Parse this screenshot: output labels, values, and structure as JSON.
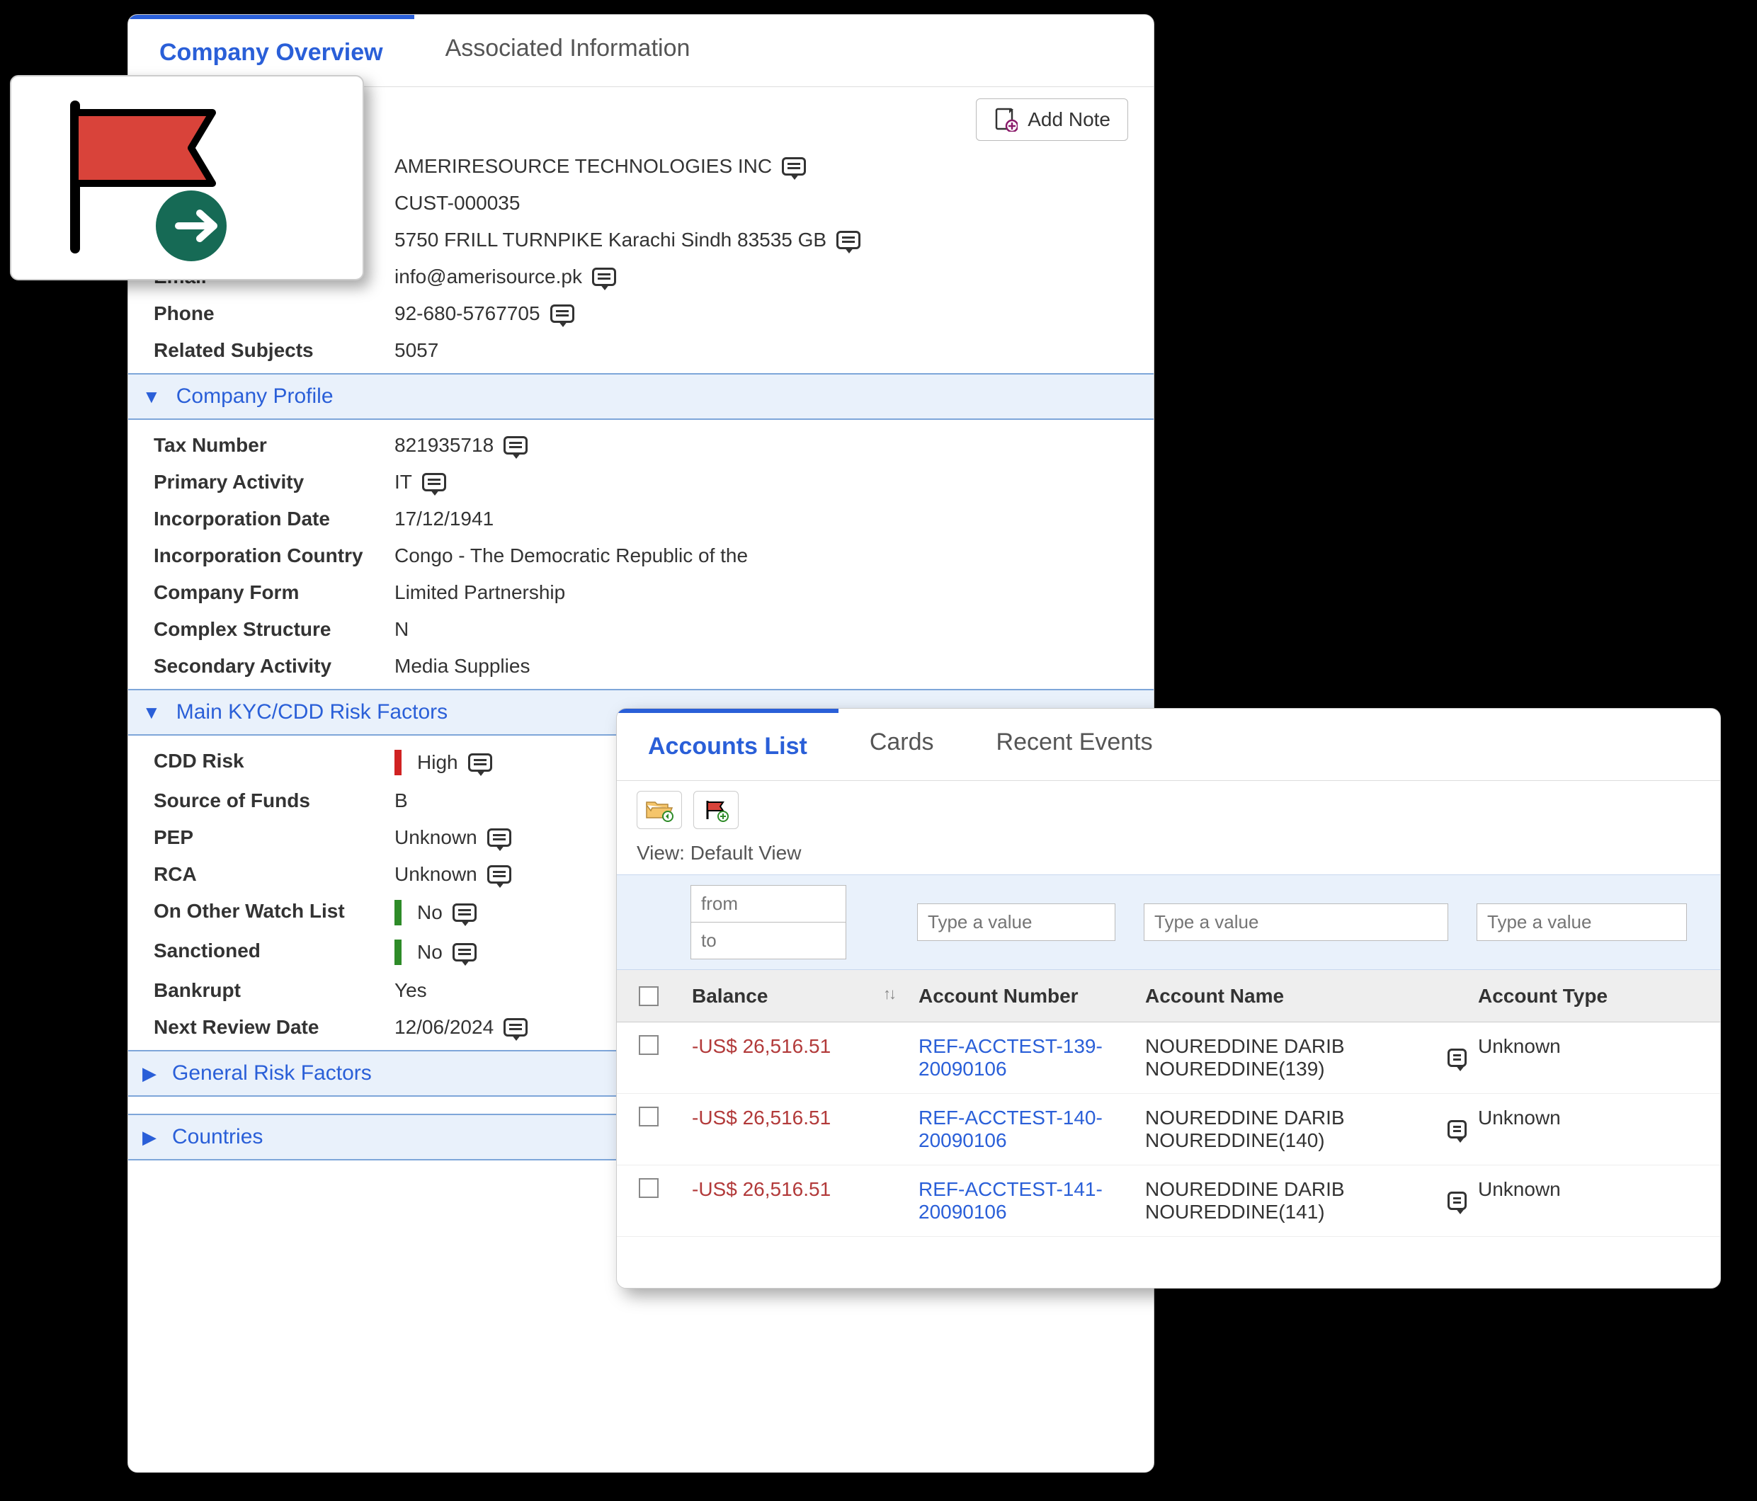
{
  "main": {
    "tabs": {
      "overview": "Company Overview",
      "associated": "Associated Information"
    },
    "add_note_label": "Add Note",
    "company_name": "AMERIRESOURCE TECHNOLOGIES INC",
    "customer_id": "CUST-000035",
    "address": "5750 FRILL TURNPIKE Karachi Sindh 83535 GB",
    "fields": {
      "email_label": "Email",
      "email": "info@amerisource.pk",
      "phone_label": "Phone",
      "phone": "92-680-5767705",
      "related_label": "Related Subjects",
      "related": "5057"
    },
    "sections": {
      "profile": "Company Profile",
      "kyc": "Main KYC/CDD Risk Factors",
      "general": "General Risk Factors",
      "countries": "Countries"
    },
    "profile": {
      "tax_label": "Tax Number",
      "tax": "821935718",
      "activity_label": "Primary Activity",
      "activity": "IT",
      "inc_date_label": "Incorporation Date",
      "inc_date": "17/12/1941",
      "inc_country_label": "Incorporation Country",
      "inc_country": "Congo - The Democratic Republic of the",
      "form_label": "Company Form",
      "form": "Limited Partnership",
      "complex_label": "Complex Structure",
      "complex": "N",
      "secondary_label": "Secondary Activity",
      "secondary": "Media Supplies"
    },
    "kyc": {
      "cdd_label": "CDD Risk",
      "cdd": "High",
      "sof_label": "Source of Funds",
      "sof": "B",
      "pep_label": "PEP",
      "pep": "Unknown",
      "rca_label": "RCA",
      "rca": "Unknown",
      "watch_label": "On Other Watch List",
      "watch": "No",
      "sanctioned_label": "Sanctioned",
      "sanctioned": "No",
      "bankrupt_label": "Bankrupt",
      "bankrupt": "Yes",
      "nextreview_label": "Next Review Date",
      "nextreview": "12/06/2024"
    }
  },
  "accounts": {
    "tabs": {
      "list": "Accounts List",
      "cards": "Cards",
      "events": "Recent Events"
    },
    "view_prefix": "View: ",
    "view_name": "Default View",
    "filters": {
      "balance_from": "from",
      "balance_to": "to",
      "generic": "Type a value"
    },
    "headers": {
      "balance": "Balance",
      "number": "Account Number",
      "name": "Account Name",
      "type": "Account Type"
    },
    "rows": [
      {
        "balance": "-US$ 26,516.51",
        "number": "REF-ACCTEST-139-20090106",
        "name": "NOUREDDINE  DARIB NOUREDDINE(139)",
        "type": "Unknown"
      },
      {
        "balance": "-US$ 26,516.51",
        "number": "REF-ACCTEST-140-20090106",
        "name": "NOUREDDINE  DARIB NOUREDDINE(140)",
        "type": "Unknown"
      },
      {
        "balance": "-US$ 26,516.51",
        "number": "REF-ACCTEST-141-20090106",
        "name": "NOUREDDINE  DARIB NOUREDDINE(141)",
        "type": "Unknown"
      }
    ]
  }
}
